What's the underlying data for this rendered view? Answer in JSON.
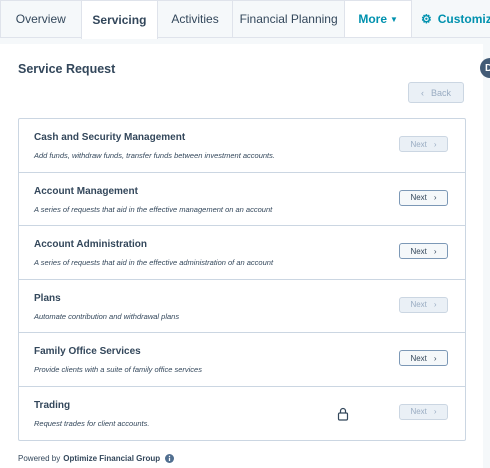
{
  "tabs": [
    {
      "label": "Overview"
    },
    {
      "label": "Servicing"
    },
    {
      "label": "Activities"
    },
    {
      "label": "Financial Planning"
    },
    {
      "label": "More"
    }
  ],
  "customize_label": "Customize",
  "title": "Service Request",
  "back_label": "Back",
  "items": [
    {
      "title": "Cash and Security Management",
      "desc": "Add funds, withdraw funds, transfer funds between investment accounts.",
      "next": "Next",
      "next_enabled": false
    },
    {
      "title": "Account Management",
      "desc": "A series of requests that aid in the effective management on an account",
      "next": "Next",
      "next_enabled": true
    },
    {
      "title": "Account Administration",
      "desc": "A series of requests that aid in the effective administration of an account",
      "next": "Next",
      "next_enabled": true
    },
    {
      "title": "Plans",
      "desc": "Automate contribution and withdrawal plans",
      "next": "Next",
      "next_enabled": false
    },
    {
      "title": "Family Office Services",
      "desc": "Provide clients with a suite of family office services",
      "next": "Next",
      "next_enabled": true
    },
    {
      "title": "Trading",
      "desc": "Request trades for client accounts.",
      "next": "Next",
      "next_enabled": false,
      "locked": true
    }
  ],
  "footer": {
    "prefix": "Powered by",
    "brand": "Optimize Financial Group"
  },
  "edge_avatar_letter": "D",
  "colors": {
    "accent": "#0091ae",
    "text": "#33475b",
    "border": "#cbd6e2",
    "disabled": "#99acc2"
  }
}
